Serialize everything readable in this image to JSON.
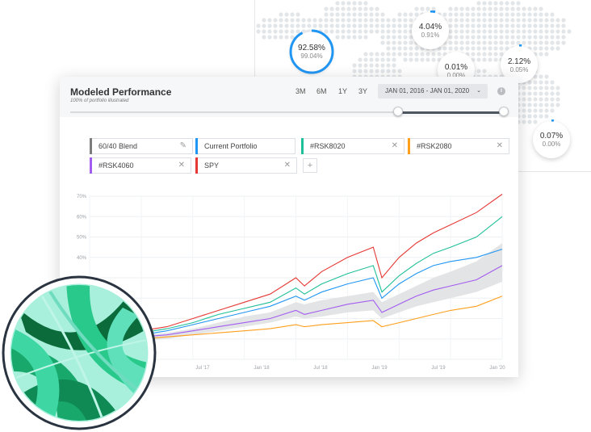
{
  "map": {
    "bubbles": [
      {
        "primary": "92.58%",
        "secondary": "99.04%",
        "progress": 0.9258
      },
      {
        "primary": "4.04%",
        "secondary": "0.91%",
        "progress": 0.0404
      },
      {
        "primary": "0.01%",
        "secondary": "0.00%",
        "progress": 0.0001
      },
      {
        "primary": "2.12%",
        "secondary": "0.05%",
        "progress": 0.0212
      },
      {
        "primary": "0.07%",
        "secondary": "0.00%",
        "progress": 0.0007
      }
    ]
  },
  "card": {
    "title": "Modeled Performance",
    "subtitle": "100% of portfolio illustrated",
    "ranges": [
      "3M",
      "6M",
      "1Y",
      "3Y"
    ],
    "date_range": "JAN 01, 2016 - JAN 01, 2020",
    "date_chevron": "⌄",
    "info_icon": "i",
    "slider_value": 0.755
  },
  "portfolios": [
    {
      "name": "60/40 Blend",
      "color": "#7d7d7d",
      "action": "✎"
    },
    {
      "name": "Current Portfolio",
      "color": "#2196f3",
      "action": ""
    },
    {
      "name": "#RSK8020",
      "color": "#1fbf99",
      "action": "✕"
    },
    {
      "name": "#RSK2080",
      "color": "#ff9f1c",
      "action": "✕"
    },
    {
      "name": "#RSK4060",
      "color": "#a35cf0",
      "action": "✕"
    },
    {
      "name": "SPY",
      "color": "#e53935",
      "action": "✕"
    }
  ],
  "add_button": "+",
  "chart_data": {
    "type": "line",
    "y_ticks": [
      "70%",
      "60%",
      "50%",
      "40%",
      "30%"
    ],
    "x_ticks": [
      "Jan '17",
      "Jul '17",
      "Jan '18",
      "Jul '18",
      "Jan '19",
      "Jul '19",
      "Jan '20"
    ],
    "ylim": [
      -10,
      70
    ],
    "x": [
      0,
      3,
      6,
      9,
      12,
      15,
      18,
      21,
      24,
      25,
      27,
      30,
      33,
      34,
      36,
      38,
      40,
      42,
      45,
      48
    ],
    "band": {
      "name": "60/40 Blend range",
      "upper": [
        0,
        1,
        2,
        3,
        5,
        8,
        11,
        13,
        18,
        17,
        19,
        21,
        23,
        18,
        22,
        26,
        30,
        33,
        38,
        47
      ],
      "lower": [
        0,
        -1,
        -1,
        0,
        2,
        4,
        6,
        8,
        11,
        10,
        11,
        13,
        14,
        10,
        13,
        16,
        18,
        20,
        23,
        28
      ]
    },
    "series": [
      {
        "name": "SPY",
        "color": "#e53935",
        "values": [
          0,
          2,
          4,
          6,
          10,
          14,
          18,
          22,
          30,
          26,
          33,
          40,
          45,
          30,
          40,
          47,
          52,
          56,
          62,
          71
        ]
      },
      {
        "name": "#RSK8020",
        "color": "#1fbf99",
        "values": [
          0,
          1,
          3,
          5,
          8,
          12,
          15,
          18,
          25,
          22,
          27,
          32,
          36,
          23,
          31,
          37,
          42,
          45,
          50,
          60
        ]
      },
      {
        "name": "Current Portfolio",
        "color": "#2196f3",
        "values": [
          0,
          1,
          2,
          4,
          7,
          10,
          13,
          16,
          21,
          19,
          23,
          27,
          30,
          20,
          27,
          32,
          36,
          38,
          40,
          44
        ]
      },
      {
        "name": "#RSK4060",
        "color": "#a35cf0",
        "values": [
          0,
          0,
          1,
          2,
          4,
          6,
          8,
          10,
          14,
          12,
          14,
          17,
          19,
          13,
          17,
          21,
          24,
          26,
          29,
          36
        ]
      },
      {
        "name": "#RSK2080",
        "color": "#ff9f1c",
        "values": [
          0,
          -1,
          0,
          1,
          2,
          3,
          4,
          5,
          7,
          6,
          7,
          8,
          9,
          6,
          8,
          10,
          12,
          14,
          16,
          21
        ]
      }
    ]
  }
}
